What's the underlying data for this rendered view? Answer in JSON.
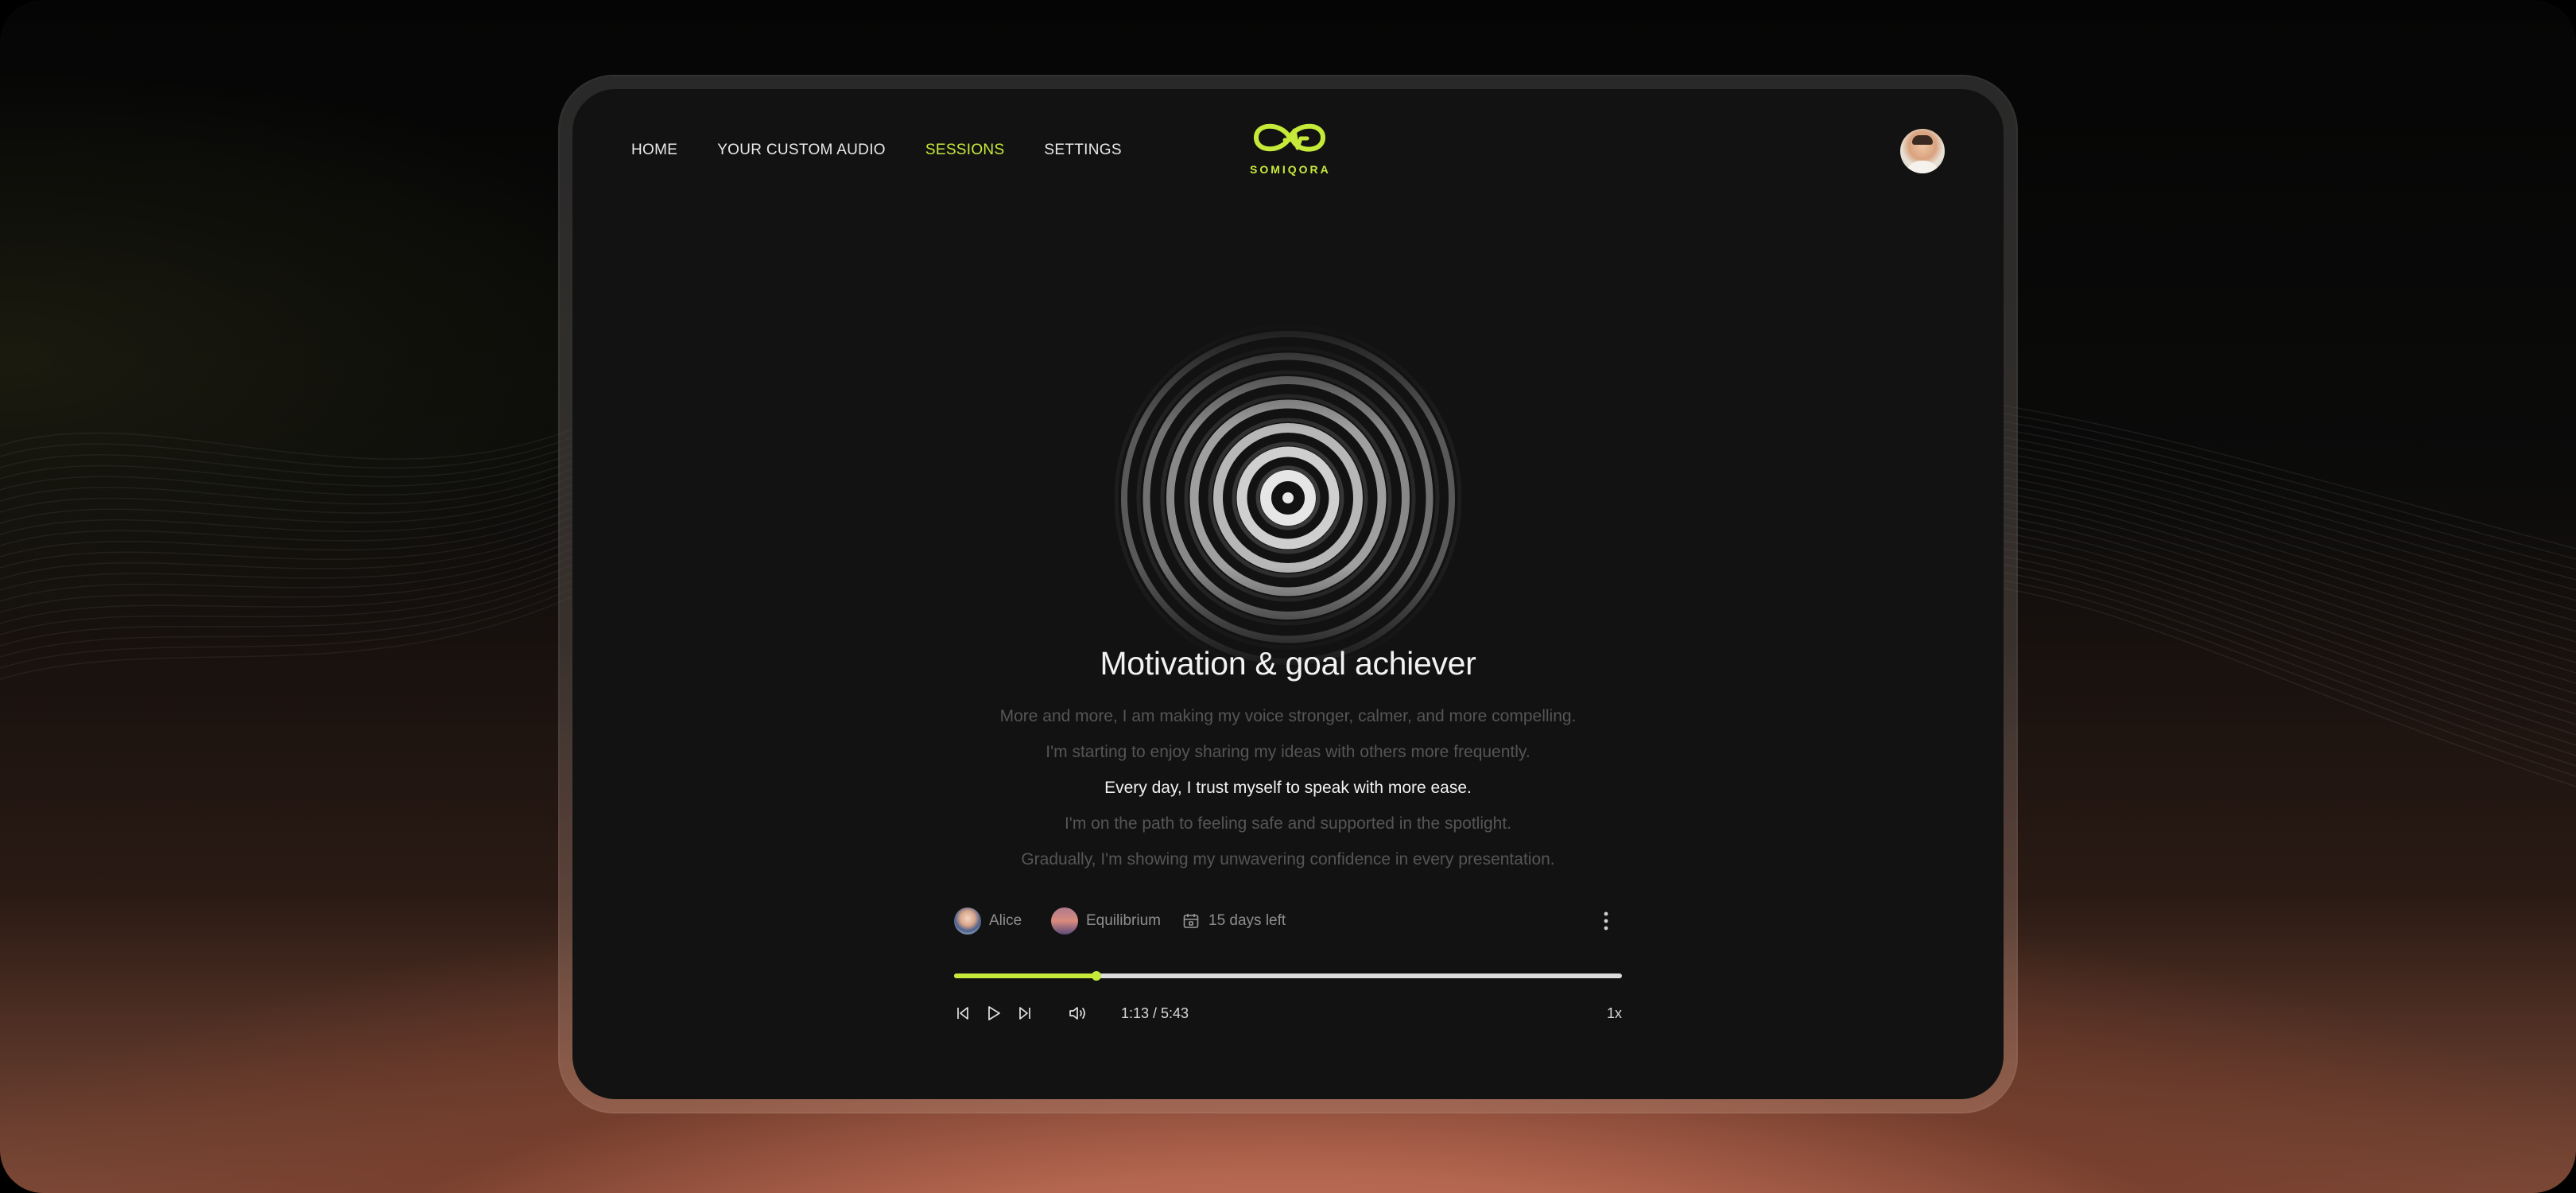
{
  "brand": {
    "name": "SOMIQORA",
    "accent": "#c6ea3a"
  },
  "nav": {
    "items": [
      {
        "label": "HOME",
        "active": false
      },
      {
        "label": "YOUR CUSTOM AUDIO",
        "active": false
      },
      {
        "label": "SESSIONS",
        "active": true
      },
      {
        "label": "SETTINGS",
        "active": false
      }
    ]
  },
  "session": {
    "title": "Motivation & goal achiever",
    "lyrics": [
      "More and more, I am making my voice stronger, calmer, and more compelling.",
      "I'm starting to enjoy sharing my ideas with others more frequently.",
      "Every day, I trust myself to speak with more ease.",
      "I'm on the path to feeling safe and supported in the spotlight.",
      "Gradually, I'm showing my unwavering confidence in every presentation."
    ],
    "current_line": 2,
    "meta": {
      "voice": "Alice",
      "soundscape": "Equilibrium",
      "days_left": "15 days left"
    }
  },
  "player": {
    "time": "1:13 / 5:43",
    "progress": 0.213,
    "speed": "1x",
    "icons": [
      "skip-back-icon",
      "play-icon",
      "skip-forward-icon",
      "volume-icon",
      "more-vertical-icon",
      "calendar-icon"
    ]
  }
}
